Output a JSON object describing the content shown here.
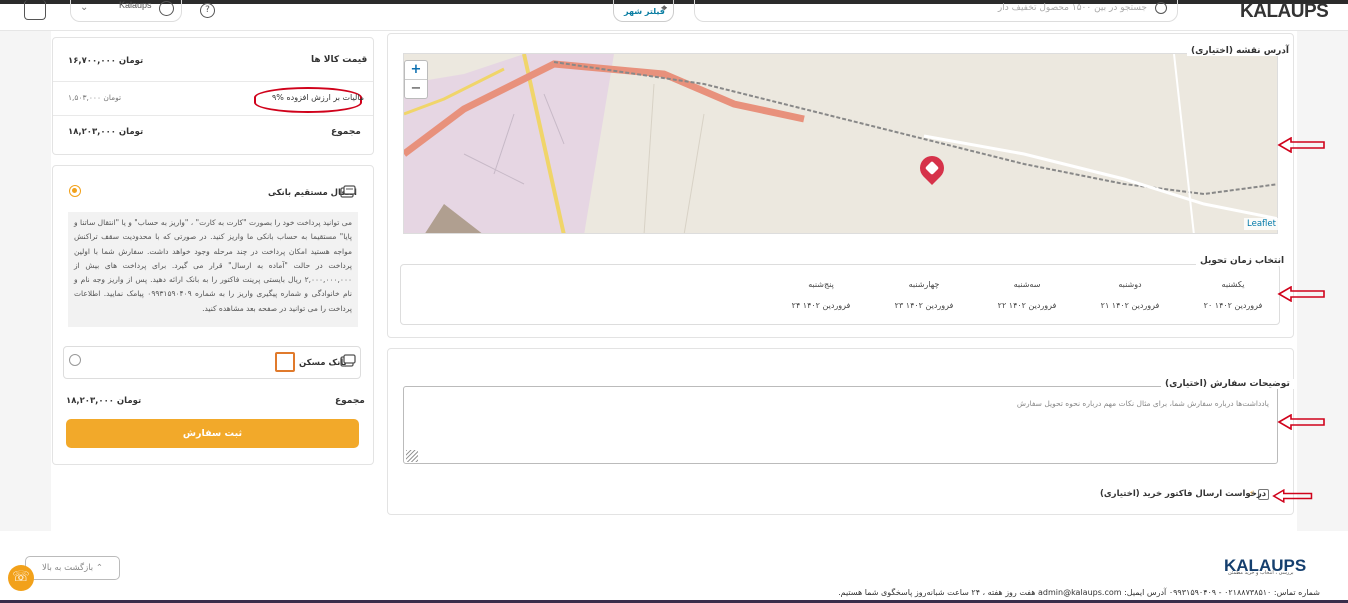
{
  "header": {
    "user_name": "Kalaups",
    "city_filter": "فیلتر شهر",
    "search_placeholder": "جستجو در بین ۱۵۰۰ محصول تخفیف دار",
    "logo": "KALAUPS"
  },
  "summary": {
    "goods_price_label": "قیمت کالا ها",
    "goods_price_value": "۱۶,۷۰۰,۰۰۰ تومان",
    "vat_label": "۹% مالیات بر ارزش افزوده",
    "vat_value": "۱,۵۰۳,۰۰۰ تومان",
    "total_label": "مجموع",
    "total_value": "۱۸,۲۰۳,۰۰۰ تومان"
  },
  "payment": {
    "bank_transfer_label": "انتقال مستقیم بانکی",
    "bank_transfer_desc": "می توانید پرداخت خود را بصورت \"کارت به کارت\" ، \"واریز به حساب\" و یا \"انتقال ساتنا و پایا\" مستقیما به حساب بانکی ما واریز کنید. در صورتی که با محدودیت سقف تراکنش مواجه هستید امکان پرداخت در چند مرحله وجود خواهد داشت. سفارش شما با اولین پرداخت در حالت \"آماده به ارسال\" قرار می گیرد. برای پرداخت های بیش از ۲,۰۰۰,۰۰۰,۰۰۰ ریال بایستی پرینت فاکتور را به بانک ارائه دهید. پس از واریز وجه نام و نام خانوادگی و شماره پیگیری واریز را به شماره ۰۹۹۳۱۵۹۰۴۰۹ پیامک نمایید. اطلاعات پرداخت را می توانید در صفحه بعد مشاهده کنید.",
    "maskan_label": "بانک مسکن",
    "total_label": "مجموع",
    "total_value": "۱۸,۲۰۳,۰۰۰ تومان",
    "submit_label": "ثبت سفارش"
  },
  "map": {
    "label": "آدرس نقشه (اختیاری)",
    "zoom_in": "+",
    "zoom_out": "−",
    "attribution": "Leaflet"
  },
  "delivery": {
    "title": "انتخاب زمان تحویل",
    "days": [
      {
        "name": "یکشنبه",
        "date": "۲۰ فروردین ۱۴۰۲"
      },
      {
        "name": "دوشنبه",
        "date": "۲۱ فروردین ۱۴۰۲"
      },
      {
        "name": "سه‌شنبه",
        "date": "۲۲ فروردین ۱۴۰۲"
      },
      {
        "name": "چهارشنبه",
        "date": "۲۳ فروردین ۱۴۰۲"
      },
      {
        "name": "پنج‌شنبه",
        "date": "۲۴ فروردین ۱۴۰۲"
      }
    ]
  },
  "notes": {
    "title": "توضیحات سفارش (اختیاری)",
    "placeholder": "یادداشت‌ها درباره سفارش شما، برای مثال نکات مهم درباره نحوه تحویل سفارش"
  },
  "invoice": {
    "label": "درخواست ارسال فاکتور خرید (اختیاری)"
  },
  "footer": {
    "back_to_top": "بازگشت به بالا",
    "logo": "KALAUPS",
    "tagline": "بررسی ، انتخاب و خرید مطمئن",
    "contact": "شماره تماس: ۰۲۱۸۸۷۳۸۵۱۰ - ۰۹۹۳۱۵۹۰۴۰۹     آدرس ایمیل: admin@kalaups.com     هفت روز هفته ، ۲۴ ساعت شبانه‌روز پاسخگوی شما هستیم."
  },
  "colors": {
    "accent": "#f2a92a",
    "annotation": "#d0021b",
    "marker": "#d6324a"
  }
}
